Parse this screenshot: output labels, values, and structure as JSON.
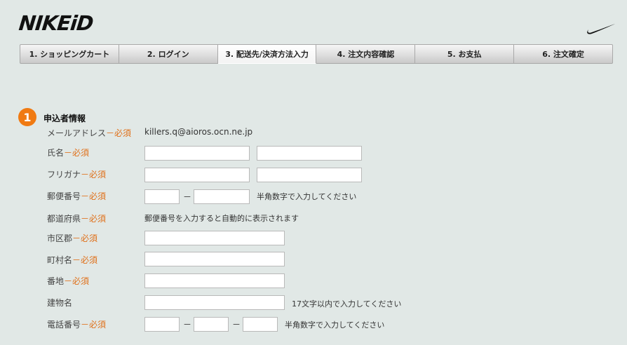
{
  "brand": {
    "logo_text": "NIKEiD",
    "swoosh_icon": "nike-swoosh-icon"
  },
  "steps": [
    {
      "label": "1. ショッピングカート"
    },
    {
      "label": "2. ログイン"
    },
    {
      "label": "3. 配送先/決済方法入力",
      "active": true
    },
    {
      "label": "4. 注文内容確認"
    },
    {
      "label": "5. お支払"
    },
    {
      "label": "6. 注文確定"
    }
  ],
  "section": {
    "number": "1",
    "title": "申込者情報"
  },
  "fields": {
    "email": {
      "label": "メールアドレス",
      "required": "－必須",
      "value": "killers.q@aioros.ocn.ne.jp"
    },
    "name": {
      "label": "氏名",
      "required": "－必須",
      "value_last": "",
      "value_first": ""
    },
    "furigana": {
      "label": "フリガナ",
      "required": "－必須",
      "value_last": "",
      "value_first": ""
    },
    "postal": {
      "label": "郵便番号",
      "required": "－必須",
      "part1": "",
      "part2": "",
      "separator": "－",
      "note": "半角数字で入力してください"
    },
    "prefecture": {
      "label": "都道府県",
      "required": "－必須",
      "value": "郵便番号を入力すると自動的に表示されます"
    },
    "city": {
      "label": "市区郡",
      "required": "－必須",
      "value": ""
    },
    "town": {
      "label": "町村名",
      "required": "－必須",
      "value": ""
    },
    "address": {
      "label": "番地",
      "required": "－必須",
      "value": ""
    },
    "building": {
      "label": "建物名",
      "value": "",
      "note": "17文字以内で入力してください"
    },
    "phone": {
      "label": "電話番号",
      "required": "－必須",
      "part1": "",
      "part2": "",
      "part3": "",
      "separator": "－",
      "note": "半角数字で入力してください"
    }
  },
  "colors": {
    "background": "#e1e8e6",
    "accent": "#f07a12",
    "required": "#e0701a"
  }
}
